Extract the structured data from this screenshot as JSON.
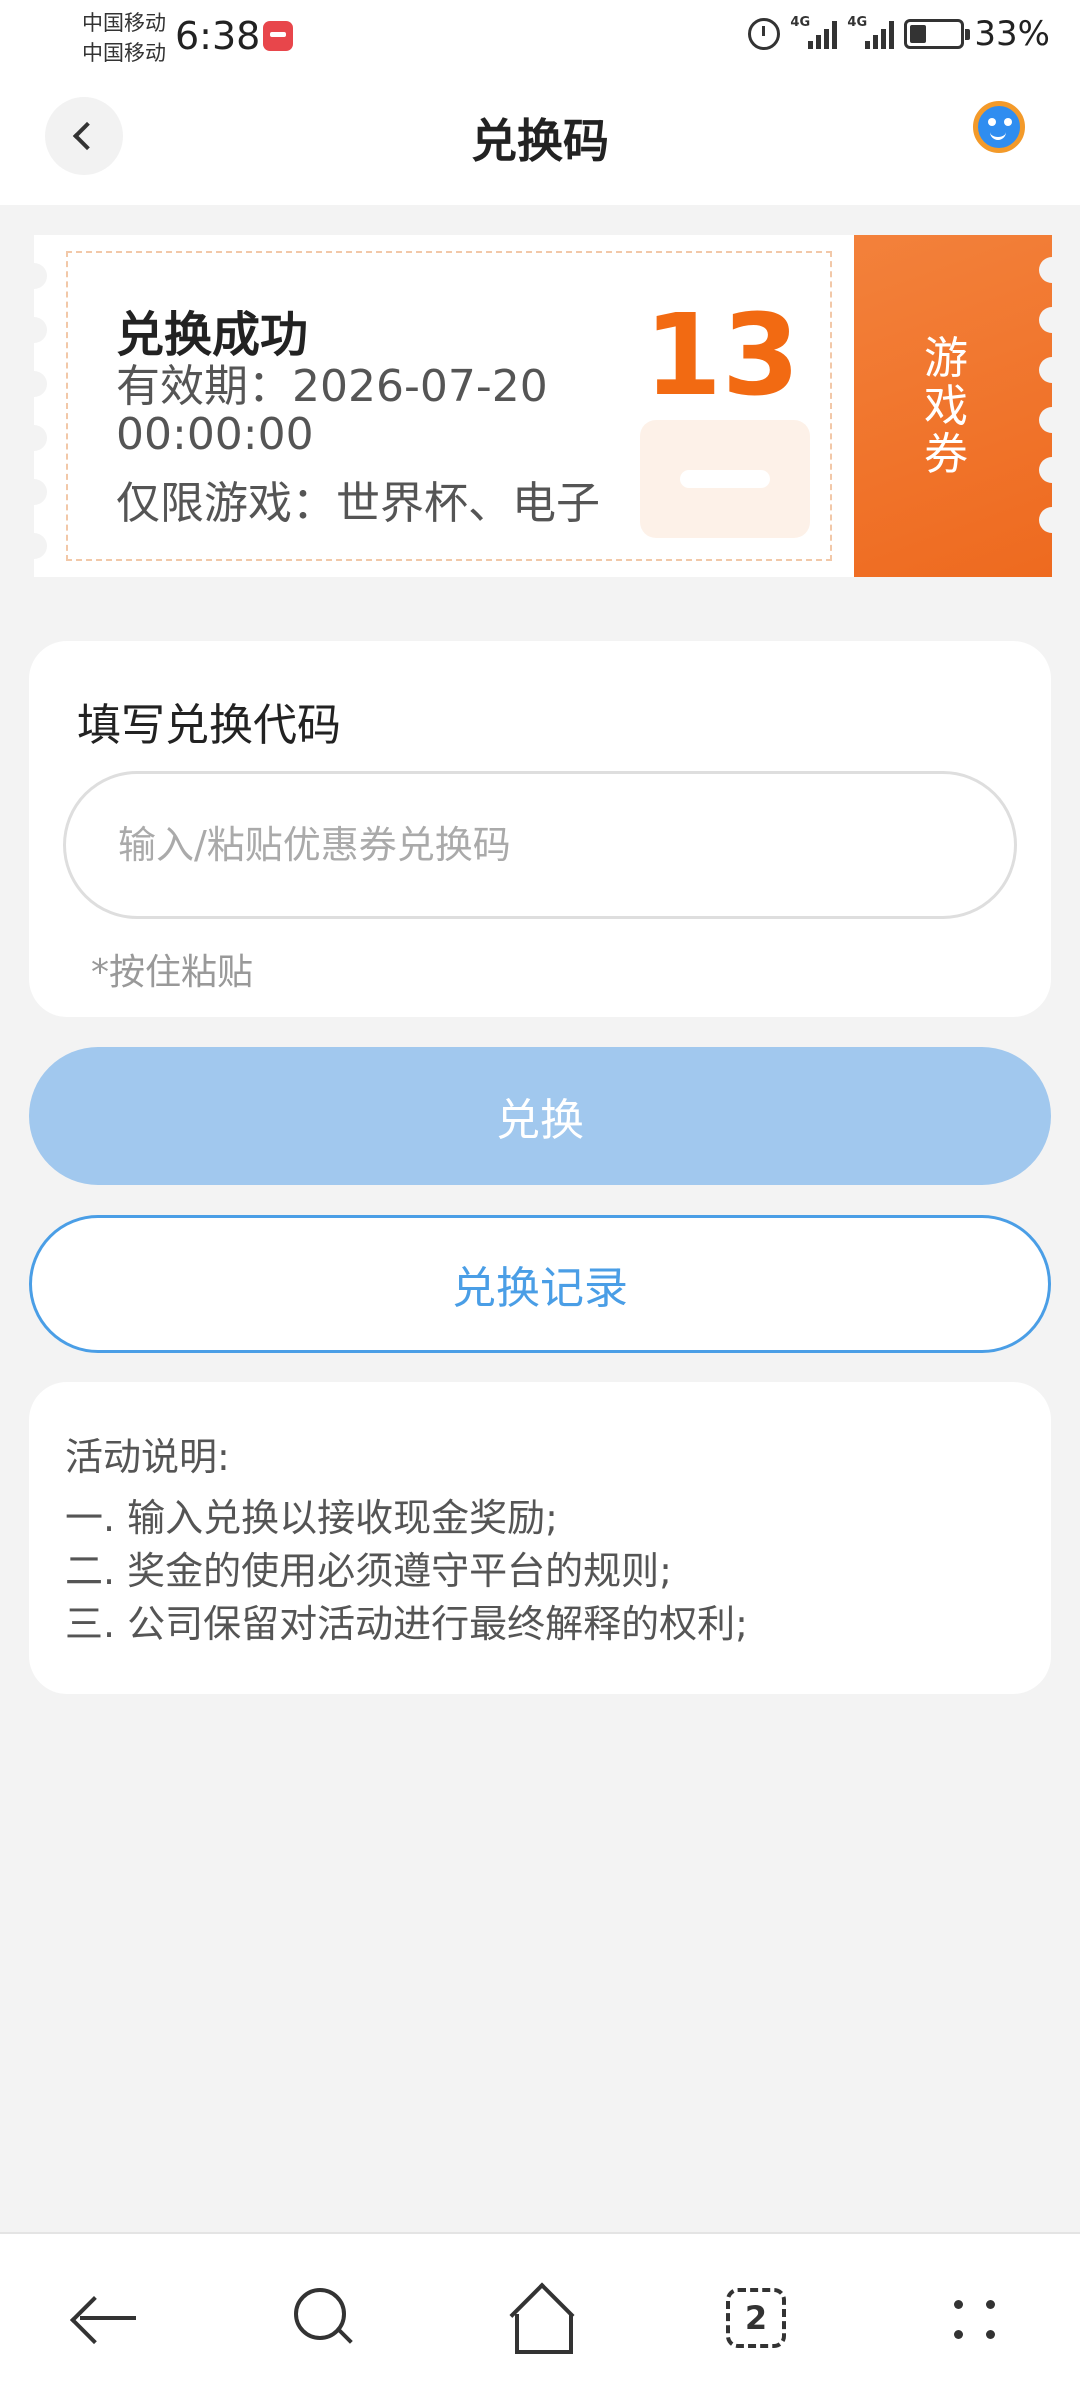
{
  "status_bar": {
    "carrier_1": "中国移动",
    "carrier_2": "中国移动",
    "time": "6:38",
    "network_1": "4G",
    "network_2": "4G",
    "battery": "33%"
  },
  "header": {
    "title": "兑换码",
    "back_icon": "chevron-left-icon",
    "service_icon": "customer-service-icon"
  },
  "coupon": {
    "status": "兑换成功",
    "validity": "有效期：2026-07-20 00:00:00",
    "games": "仅限游戏：世界杯、电子",
    "amount": "13",
    "type_label": "游戏券",
    "accent_color": "#f26a12"
  },
  "form": {
    "label": "填写兑换代码",
    "input_value": "",
    "input_placeholder": "输入/粘贴优惠券兑换码",
    "paste_hint": "*按住粘贴"
  },
  "buttons": {
    "redeem": "兑换",
    "history": "兑换记录",
    "redeem_color": "#a1c8ee",
    "history_color": "#4a9ee6"
  },
  "info": {
    "title": "活动说明:",
    "items": [
      "一. 输入兑换以接收现金奖励;",
      "二. 奖金的使用必须遵守平台的规则;",
      "三. 公司保留对活动进行最终解释的权利;"
    ]
  },
  "nav": {
    "tab_count": "2"
  }
}
